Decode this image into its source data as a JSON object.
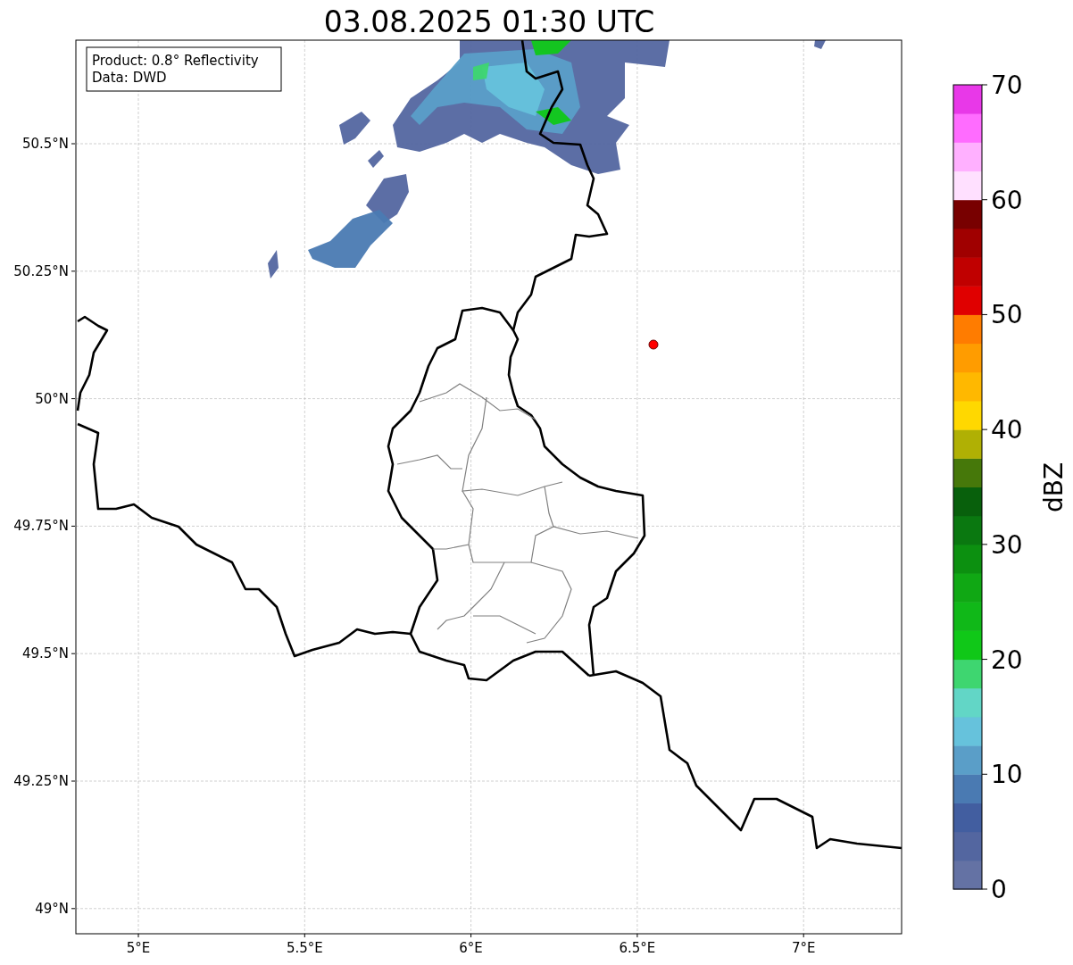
{
  "title": "03.08.2025 01:30 UTC",
  "info_box": [
    "Product: 0.8° Reflectivity",
    "Data: DWD"
  ],
  "map": {
    "x_ticks": [
      "5°E",
      "5.5°E",
      "6°E",
      "6.5°E",
      "7°E"
    ],
    "y_ticks": [
      "50.5°N",
      "50.25°N",
      "50°N",
      "49.75°N",
      "49.5°N",
      "49.25°N",
      "49°N"
    ]
  },
  "colorbar": {
    "label": "dBZ",
    "ticks": [
      "70",
      "60",
      "50",
      "40",
      "30",
      "20",
      "10",
      "0"
    ],
    "bins": [
      {
        "color": "#6472a4"
      },
      {
        "color": "#5366a0"
      },
      {
        "color": "#425ea0"
      },
      {
        "color": "#4a7ab2"
      },
      {
        "color": "#5a9ec8"
      },
      {
        "color": "#66c2dc"
      },
      {
        "color": "#62d6c6"
      },
      {
        "color": "#3ed670"
      },
      {
        "color": "#10c818"
      },
      {
        "color": "#10b818"
      },
      {
        "color": "#10a814"
      },
      {
        "color": "#0c9010"
      },
      {
        "color": "#0a7810"
      },
      {
        "color": "#08600c"
      },
      {
        "color": "#46780a"
      },
      {
        "color": "#b0b004"
      },
      {
        "color": "#ffd800"
      },
      {
        "color": "#ffb800"
      },
      {
        "color": "#ff9c00"
      },
      {
        "color": "#ff7c00"
      },
      {
        "color": "#e00000"
      },
      {
        "color": "#c00000"
      },
      {
        "color": "#a00000"
      },
      {
        "color": "#780000"
      },
      {
        "color": "#ffe0ff"
      },
      {
        "color": "#ffb0ff"
      },
      {
        "color": "#ff6cff"
      },
      {
        "color": "#e838e8"
      }
    ]
  }
}
